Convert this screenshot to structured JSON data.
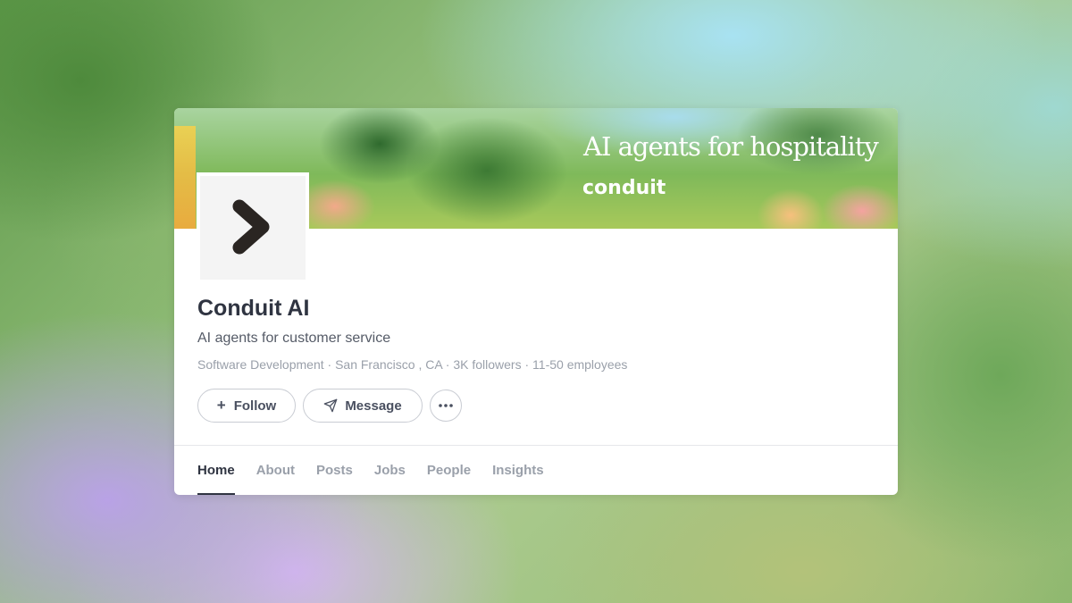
{
  "banner": {
    "tagline": "AI agents for hospitality",
    "brand": "conduit"
  },
  "company": {
    "name": "Conduit AI",
    "tagline": "AI agents for customer service",
    "meta": "Software Development · San Francisco , CA · 3K followers · 11-50 employees"
  },
  "actions": {
    "follow_label": "Follow",
    "message_label": "Message"
  },
  "tabs": [
    {
      "label": "Home",
      "active": true
    },
    {
      "label": "About"
    },
    {
      "label": "Posts"
    },
    {
      "label": "Jobs"
    },
    {
      "label": "People"
    },
    {
      "label": "Insights"
    }
  ],
  "icons": {
    "logo": "chevron-right-logo",
    "follow": "plus-icon",
    "message": "send-icon",
    "more": "more-horizontal-icon"
  },
  "colors": {
    "text_primary": "#2f3441",
    "text_secondary": "#555b67",
    "text_muted": "#9aa0aa",
    "border": "#c9ccd3"
  }
}
